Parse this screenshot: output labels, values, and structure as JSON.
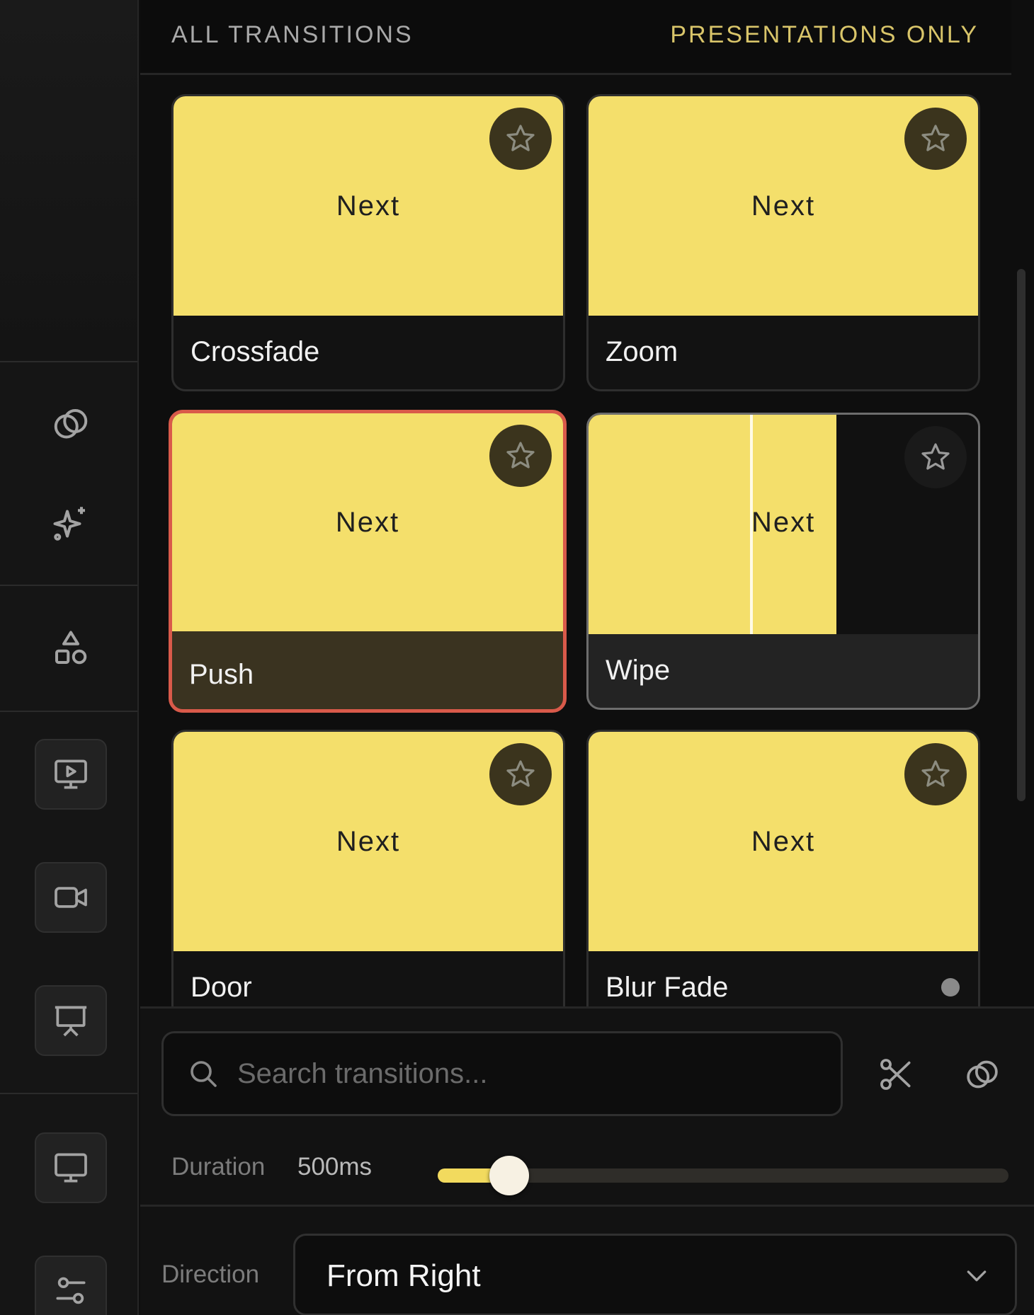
{
  "tabs": {
    "all": "ALL TRANSITIONS",
    "presentations": "PRESENTATIONS ONLY"
  },
  "cards": [
    {
      "label": "Crossfade",
      "thumb_text": "Next"
    },
    {
      "label": "Zoom",
      "thumb_text": "Next"
    },
    {
      "label": "Push",
      "thumb_text": "Next",
      "state": "selected"
    },
    {
      "label": "Wipe",
      "thumb_text": "Next",
      "state": "hover"
    },
    {
      "label": "Door",
      "thumb_text": "Next"
    },
    {
      "label": "Blur Fade",
      "thumb_text": "Next"
    }
  ],
  "search": {
    "placeholder": "Search transitions..."
  },
  "duration": {
    "label": "Duration",
    "value": "500ms",
    "slider_fraction": 0.125
  },
  "direction": {
    "label": "Direction",
    "value": "From Right"
  },
  "colors": {
    "accent_yellow": "#f4df6b",
    "selected_border": "#d95a4a",
    "tab_active": "#d9c56a"
  },
  "icons": {
    "rail": [
      "overlap-circles-icon",
      "sparkles-icon",
      "shapes-icon",
      "monitor-play-icon",
      "video-camera-icon",
      "presentation-icon",
      "monitor-icon",
      "sliders-icon"
    ],
    "tools": [
      "scissors-icon",
      "overlap-circles-icon"
    ]
  }
}
